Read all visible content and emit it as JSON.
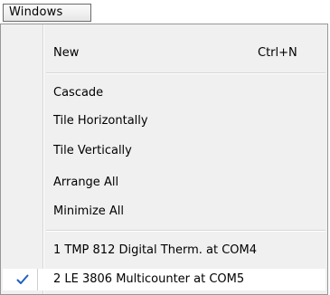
{
  "menubar": {
    "windows_label": "Windows"
  },
  "menu": {
    "new": {
      "label": "New",
      "shortcut": "Ctrl+N"
    },
    "cascade": "Cascade",
    "tile_horizontally": "Tile Horizontally",
    "tile_vertically": "Tile Vertically",
    "arrange_all": "Arrange All",
    "minimize_all": "Minimize All",
    "windows": [
      {
        "label": "1 TMP 812 Digital Therm. at COM4",
        "checked": false
      },
      {
        "label": "2 LE 3806 Multicounter at COM5",
        "checked": true
      }
    ]
  },
  "colors": {
    "menu_background": "#f0f0f0",
    "checkmark": "#1f5fbf"
  }
}
